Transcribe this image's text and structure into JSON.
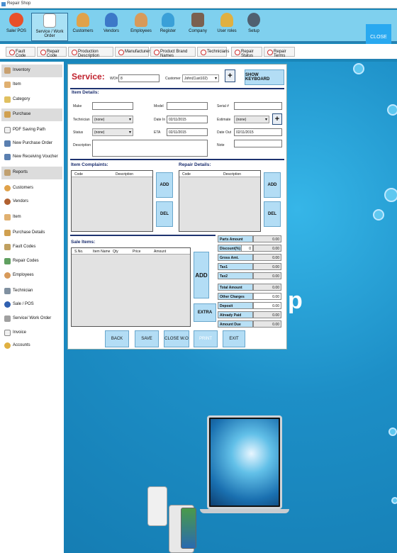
{
  "window": {
    "title": "Repair Shop"
  },
  "ribbon": {
    "items": [
      {
        "label": "Sale/ POS",
        "color": "#e8502a"
      },
      {
        "label": "Service / Work Order",
        "color": "#ffffff"
      },
      {
        "label": "Customers",
        "color": "#e0a24a"
      },
      {
        "label": "Vendors",
        "color": "#3c78c8"
      },
      {
        "label": "Employees",
        "color": "#d89a5a"
      },
      {
        "label": "Register",
        "color": "#3aa0d8"
      },
      {
        "label": "Company",
        "color": "#7a6050"
      },
      {
        "label": "User roles",
        "color": "#e0b040"
      },
      {
        "label": "Setup",
        "color": "#506070"
      }
    ],
    "close_label": "CLOSE"
  },
  "subnav": [
    "Fault Code",
    "Repair Code",
    "Production Description",
    "Manufacturers",
    "Product Brand Names",
    "Technicians",
    "Repair Status",
    "Repair Terms"
  ],
  "sidebar": [
    {
      "label": "Inventory",
      "header": true
    },
    {
      "label": "Item"
    },
    {
      "label": "Category"
    },
    {
      "label": "Purchase",
      "header": true
    },
    {
      "label": "PDF Saving Path"
    },
    {
      "label": "New Purchase Order"
    },
    {
      "label": "New Receiving Voucher"
    },
    {
      "label": "Reports",
      "header": true
    },
    {
      "label": "Customers"
    },
    {
      "label": "Vendors"
    },
    {
      "label": "Item"
    },
    {
      "label": "Purchase Details"
    },
    {
      "label": "Fault Codes"
    },
    {
      "label": "Repair Codes"
    },
    {
      "label": "Employees"
    },
    {
      "label": "Technician"
    },
    {
      "label": "Sale / POS"
    },
    {
      "label": "Service/ Work Order"
    },
    {
      "label": "Invoice"
    },
    {
      "label": "Accounts"
    }
  ],
  "form": {
    "title": "Service:",
    "wo_label": "WO#",
    "wo_value": "8",
    "customer_label": "Customer",
    "customer_value": "John(Cust102)",
    "show_keyboard": "SHOW KEYBOARD",
    "item_details": "Item Details:",
    "make_label": "Make",
    "model_label": "Model",
    "serial_label": "Serial #",
    "technician_label": "Technician",
    "technician_value": "(none)",
    "date_in_label": "Date In",
    "date_in_value": "02/11/2015",
    "estimate_label": "Estimate",
    "estimate_value": "(none)",
    "status_label": "Status",
    "status_value": "(none)",
    "eta_label": "ETA",
    "eta_value": "02/11/2015",
    "date_out_label": "Date Out",
    "date_out_value": "02/11/2015",
    "description_label": "Description",
    "note_label": "Note",
    "complaints_title": "Item Complaints:",
    "repair_title": "Repair Details:",
    "col_code": "Code",
    "col_description": "Description",
    "add": "ADD",
    "del": "DEL",
    "sale_items_title": "Sale Items:",
    "sale_cols": [
      "S.No.",
      "Item Name",
      "Qty",
      "Price",
      "Amount"
    ],
    "extra": "EXTRA",
    "totals": [
      {
        "label": "Parts Amount",
        "value": "0.00"
      },
      {
        "label": "Discount(%)",
        "value": "0.00",
        "pct": "0"
      },
      {
        "label": "Gross Amt.",
        "value": "0.00"
      },
      {
        "label": "Tax1",
        "value": "0.00"
      },
      {
        "label": "Tax2",
        "value": "0.00"
      },
      {
        "label": "Total Amount",
        "value": "0.00"
      },
      {
        "label": "Other Charges",
        "value": "0.00"
      },
      {
        "label": "Deposit",
        "value": "0.00"
      },
      {
        "label": "Already Paid",
        "value": "0.00"
      },
      {
        "label": "Amount Due",
        "value": "0.00"
      }
    ],
    "buttons": [
      "BACK",
      "SAVE",
      "CLOSE W.O",
      "PRINT",
      "EXIT"
    ]
  },
  "background": {
    "big_letter": "p"
  }
}
